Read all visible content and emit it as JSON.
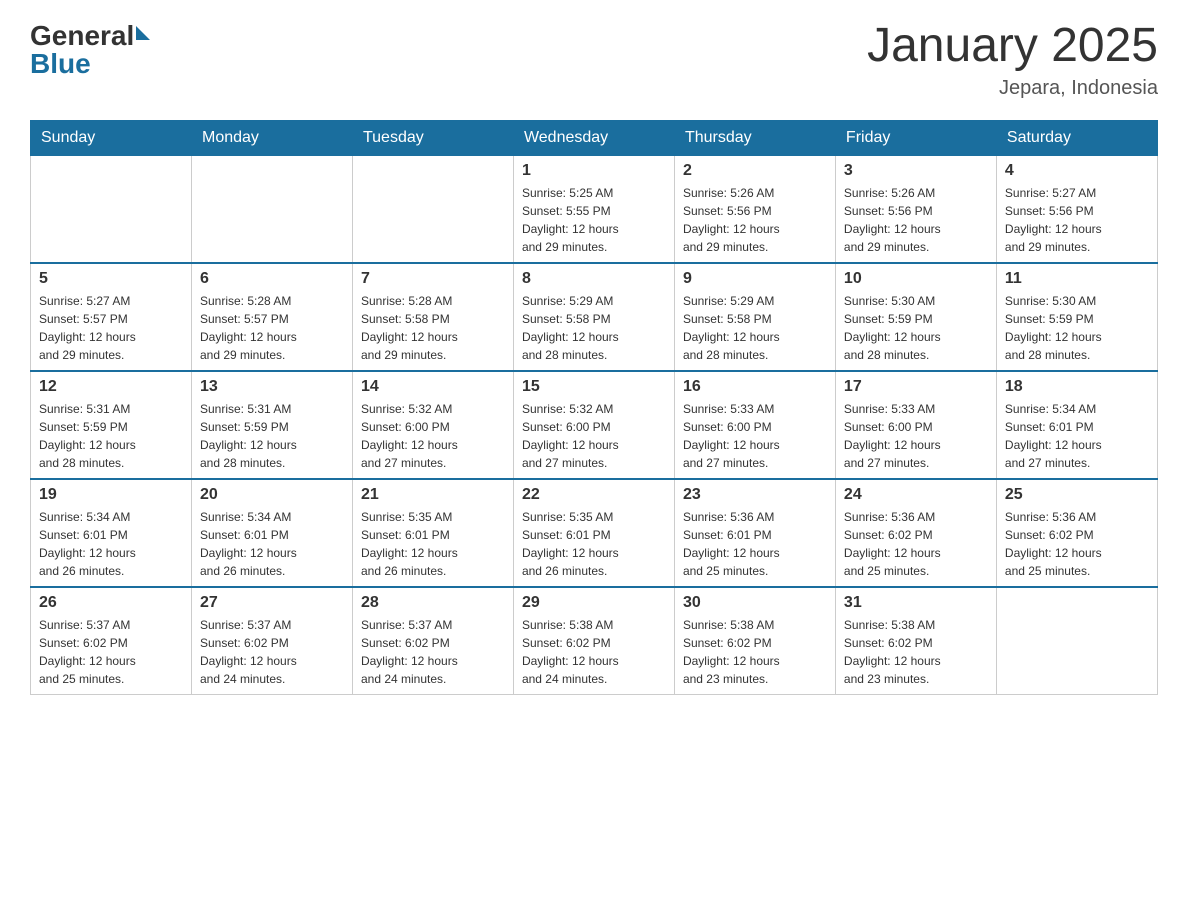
{
  "logo": {
    "general": "General",
    "blue": "Blue",
    "arrow_color": "#1a6e9e"
  },
  "title": "January 2025",
  "subtitle": "Jepara, Indonesia",
  "days_of_week": [
    "Sunday",
    "Monday",
    "Tuesday",
    "Wednesday",
    "Thursday",
    "Friday",
    "Saturday"
  ],
  "weeks": [
    [
      {
        "date": "",
        "info": ""
      },
      {
        "date": "",
        "info": ""
      },
      {
        "date": "",
        "info": ""
      },
      {
        "date": "1",
        "info": "Sunrise: 5:25 AM\nSunset: 5:55 PM\nDaylight: 12 hours\nand 29 minutes."
      },
      {
        "date": "2",
        "info": "Sunrise: 5:26 AM\nSunset: 5:56 PM\nDaylight: 12 hours\nand 29 minutes."
      },
      {
        "date": "3",
        "info": "Sunrise: 5:26 AM\nSunset: 5:56 PM\nDaylight: 12 hours\nand 29 minutes."
      },
      {
        "date": "4",
        "info": "Sunrise: 5:27 AM\nSunset: 5:56 PM\nDaylight: 12 hours\nand 29 minutes."
      }
    ],
    [
      {
        "date": "5",
        "info": "Sunrise: 5:27 AM\nSunset: 5:57 PM\nDaylight: 12 hours\nand 29 minutes."
      },
      {
        "date": "6",
        "info": "Sunrise: 5:28 AM\nSunset: 5:57 PM\nDaylight: 12 hours\nand 29 minutes."
      },
      {
        "date": "7",
        "info": "Sunrise: 5:28 AM\nSunset: 5:58 PM\nDaylight: 12 hours\nand 29 minutes."
      },
      {
        "date": "8",
        "info": "Sunrise: 5:29 AM\nSunset: 5:58 PM\nDaylight: 12 hours\nand 28 minutes."
      },
      {
        "date": "9",
        "info": "Sunrise: 5:29 AM\nSunset: 5:58 PM\nDaylight: 12 hours\nand 28 minutes."
      },
      {
        "date": "10",
        "info": "Sunrise: 5:30 AM\nSunset: 5:59 PM\nDaylight: 12 hours\nand 28 minutes."
      },
      {
        "date": "11",
        "info": "Sunrise: 5:30 AM\nSunset: 5:59 PM\nDaylight: 12 hours\nand 28 minutes."
      }
    ],
    [
      {
        "date": "12",
        "info": "Sunrise: 5:31 AM\nSunset: 5:59 PM\nDaylight: 12 hours\nand 28 minutes."
      },
      {
        "date": "13",
        "info": "Sunrise: 5:31 AM\nSunset: 5:59 PM\nDaylight: 12 hours\nand 28 minutes."
      },
      {
        "date": "14",
        "info": "Sunrise: 5:32 AM\nSunset: 6:00 PM\nDaylight: 12 hours\nand 27 minutes."
      },
      {
        "date": "15",
        "info": "Sunrise: 5:32 AM\nSunset: 6:00 PM\nDaylight: 12 hours\nand 27 minutes."
      },
      {
        "date": "16",
        "info": "Sunrise: 5:33 AM\nSunset: 6:00 PM\nDaylight: 12 hours\nand 27 minutes."
      },
      {
        "date": "17",
        "info": "Sunrise: 5:33 AM\nSunset: 6:00 PM\nDaylight: 12 hours\nand 27 minutes."
      },
      {
        "date": "18",
        "info": "Sunrise: 5:34 AM\nSunset: 6:01 PM\nDaylight: 12 hours\nand 27 minutes."
      }
    ],
    [
      {
        "date": "19",
        "info": "Sunrise: 5:34 AM\nSunset: 6:01 PM\nDaylight: 12 hours\nand 26 minutes."
      },
      {
        "date": "20",
        "info": "Sunrise: 5:34 AM\nSunset: 6:01 PM\nDaylight: 12 hours\nand 26 minutes."
      },
      {
        "date": "21",
        "info": "Sunrise: 5:35 AM\nSunset: 6:01 PM\nDaylight: 12 hours\nand 26 minutes."
      },
      {
        "date": "22",
        "info": "Sunrise: 5:35 AM\nSunset: 6:01 PM\nDaylight: 12 hours\nand 26 minutes."
      },
      {
        "date": "23",
        "info": "Sunrise: 5:36 AM\nSunset: 6:01 PM\nDaylight: 12 hours\nand 25 minutes."
      },
      {
        "date": "24",
        "info": "Sunrise: 5:36 AM\nSunset: 6:02 PM\nDaylight: 12 hours\nand 25 minutes."
      },
      {
        "date": "25",
        "info": "Sunrise: 5:36 AM\nSunset: 6:02 PM\nDaylight: 12 hours\nand 25 minutes."
      }
    ],
    [
      {
        "date": "26",
        "info": "Sunrise: 5:37 AM\nSunset: 6:02 PM\nDaylight: 12 hours\nand 25 minutes."
      },
      {
        "date": "27",
        "info": "Sunrise: 5:37 AM\nSunset: 6:02 PM\nDaylight: 12 hours\nand 24 minutes."
      },
      {
        "date": "28",
        "info": "Sunrise: 5:37 AM\nSunset: 6:02 PM\nDaylight: 12 hours\nand 24 minutes."
      },
      {
        "date": "29",
        "info": "Sunrise: 5:38 AM\nSunset: 6:02 PM\nDaylight: 12 hours\nand 24 minutes."
      },
      {
        "date": "30",
        "info": "Sunrise: 5:38 AM\nSunset: 6:02 PM\nDaylight: 12 hours\nand 23 minutes."
      },
      {
        "date": "31",
        "info": "Sunrise: 5:38 AM\nSunset: 6:02 PM\nDaylight: 12 hours\nand 23 minutes."
      },
      {
        "date": "",
        "info": ""
      }
    ]
  ]
}
